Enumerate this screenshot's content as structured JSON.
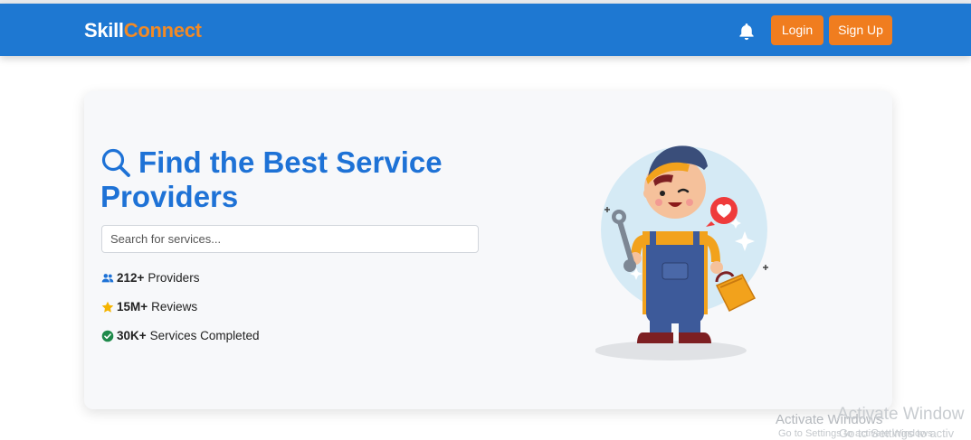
{
  "brand": {
    "part1": "Skill",
    "part2": "Connect",
    "color_main": "#1e78d2",
    "color_accent": "#f28a25"
  },
  "nav": {
    "notification_icon": "bell-icon",
    "login_label": "Login",
    "signup_label": "Sign Up"
  },
  "hero": {
    "title": "Find the Best Service Providers",
    "search_icon": "magnifier-icon",
    "search_placeholder": "Search for services...",
    "search_value": "",
    "stats": [
      {
        "icon": "users-icon",
        "value": "212+",
        "label": "Providers",
        "color": "#1e72d6"
      },
      {
        "icon": "star-icon",
        "value": "15M+",
        "label": "Reviews",
        "color": "#f5b400"
      },
      {
        "icon": "check-circle-icon",
        "value": "30K+",
        "label": "Services Completed",
        "color": "#1e8a4a"
      }
    ],
    "illustration": "repairman-with-toolbox"
  },
  "os_watermark": {
    "line1": "Activate Windows",
    "line2": "Go to Settings to activate Windows.",
    "line1b": "Activate Window",
    "line2b": "Go to Settings to activ"
  }
}
